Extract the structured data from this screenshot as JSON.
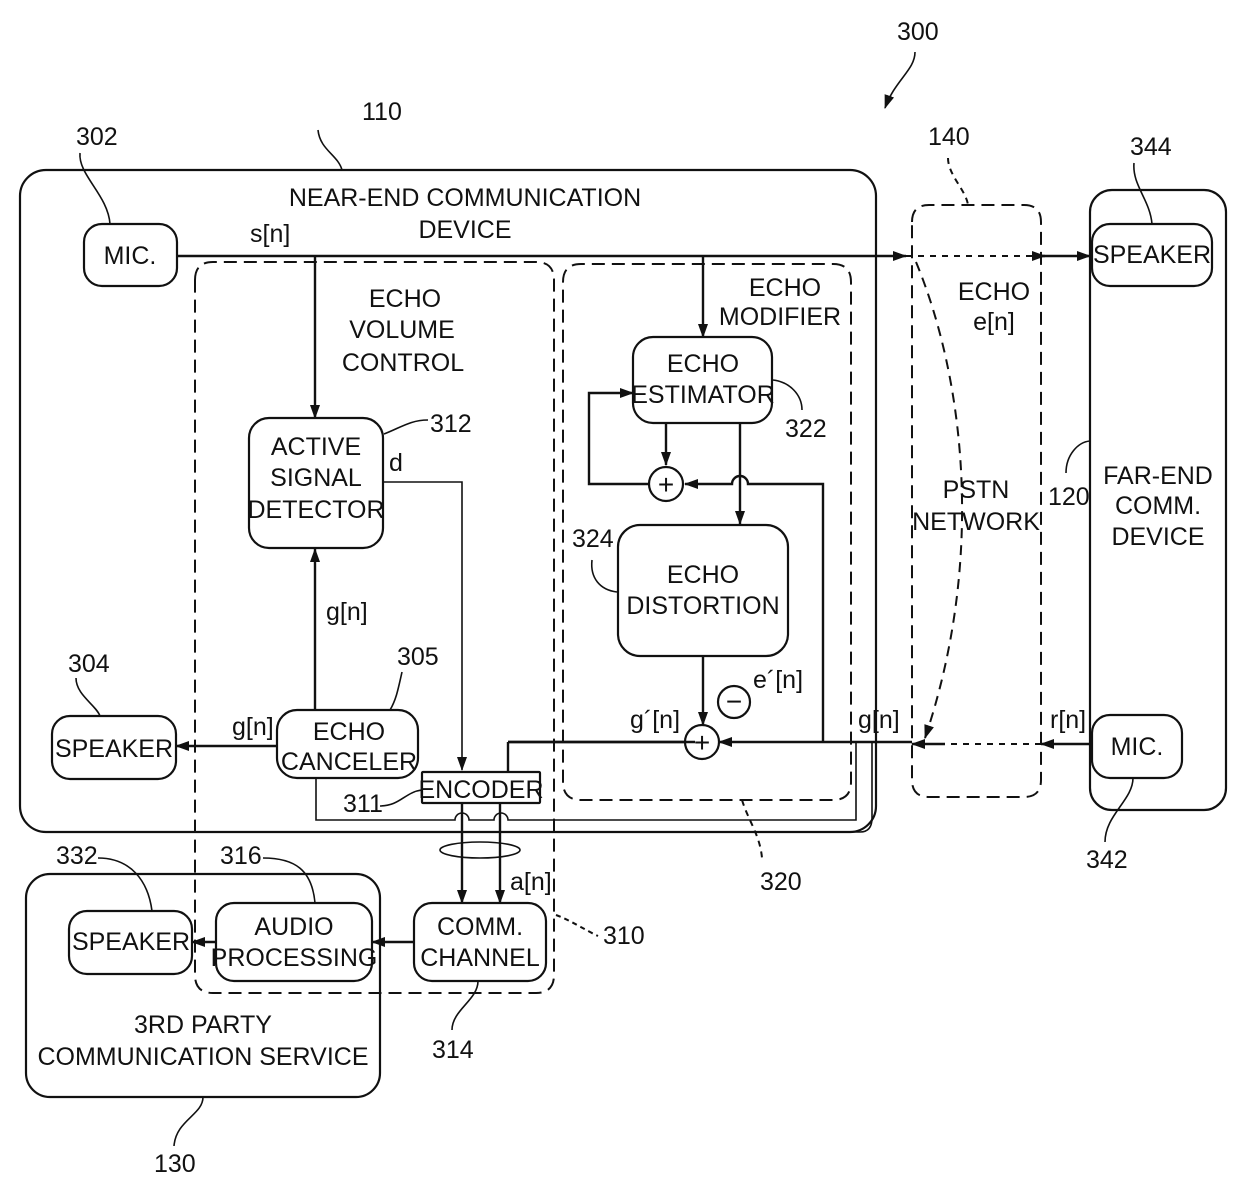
{
  "figure": {
    "ref": "300"
  },
  "near_end": {
    "ref": "110",
    "title_line1": "NEAR-END COMMUNICATION",
    "title_line2": "DEVICE",
    "mic": {
      "label": "MIC.",
      "ref": "302"
    },
    "speaker": {
      "label": "SPEAKER",
      "ref": "304"
    },
    "echo_canceler": {
      "line1": "ECHO",
      "line2": "CANCELER",
      "ref": "305"
    },
    "encoder": {
      "label": "ENCODER",
      "ref": "311"
    },
    "echo_volume_control": {
      "ref": "310",
      "line1": "ECHO",
      "line2": "VOLUME",
      "line3": "CONTROL",
      "active_signal_detector": {
        "line1": "ACTIVE",
        "line2": "SIGNAL",
        "line3": "DETECTOR",
        "ref": "312"
      },
      "comm_channel": {
        "line1": "COMM.",
        "line2": "CHANNEL",
        "ref": "314"
      },
      "audio_processing": {
        "line1": "AUDIO",
        "line2": "PROCESSING",
        "ref": "316"
      }
    },
    "echo_modifier": {
      "ref": "320",
      "line1": "ECHO",
      "line2": "MODIFIER",
      "echo_estimator": {
        "line1": "ECHO",
        "line2": "ESTIMATOR",
        "ref": "322"
      },
      "echo_distortion": {
        "line1": "ECHO",
        "line2": "DISTORTION",
        "ref": "324"
      }
    }
  },
  "network": {
    "ref": "140",
    "line1": "PSTN",
    "line2": "NETWORK",
    "echo_line1": "ECHO",
    "echo_line2": "e[n]"
  },
  "far_end": {
    "ref": "120",
    "line1": "FAR-END",
    "line2": "COMM.",
    "line3": "DEVICE",
    "speaker": {
      "label": "SPEAKER",
      "ref": "344"
    },
    "mic": {
      "label": "MIC.",
      "ref": "342"
    }
  },
  "third_party": {
    "ref": "130",
    "line1": "3RD PARTY",
    "line2": "COMMUNICATION SERVICE",
    "speaker": {
      "label": "SPEAKER",
      "ref": "332"
    }
  },
  "signals": {
    "s": "s[n]",
    "g_top": "g[n]",
    "g_left": "g[n]",
    "g_right": "g[n]",
    "g_prime": "g´[n]",
    "e_prime": "e´[n]",
    "r": "r[n]",
    "a": "a[n]",
    "d": "d"
  },
  "operators": {
    "plus": "+",
    "minus": "−"
  }
}
